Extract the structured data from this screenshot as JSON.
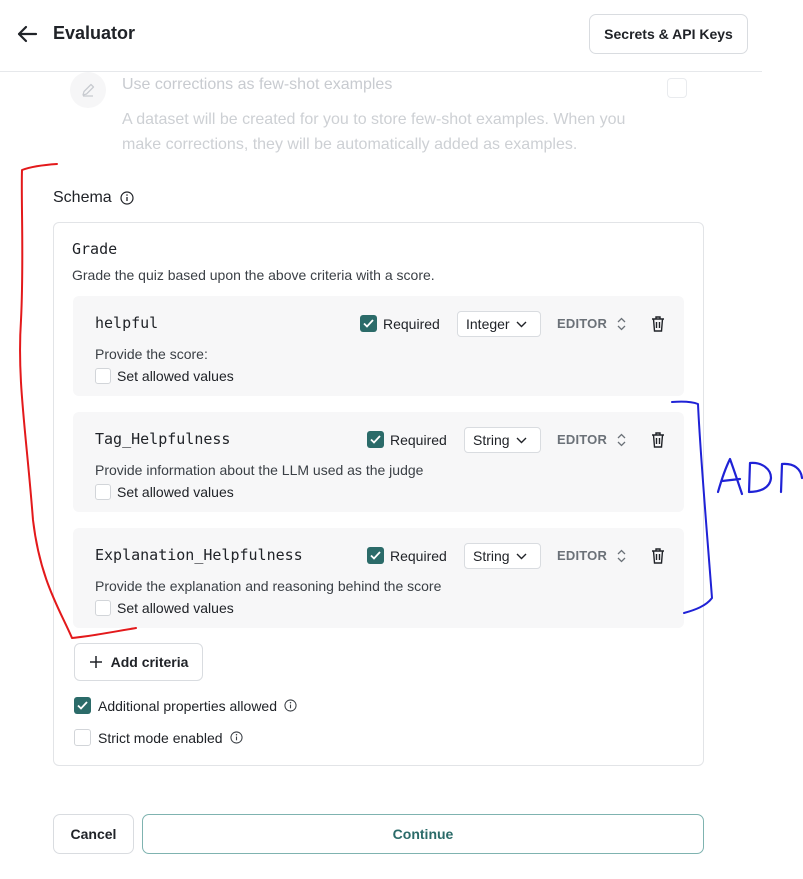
{
  "header": {
    "title": "Evaluator",
    "secrets_button": "Secrets & API Keys"
  },
  "fewshot": {
    "title": "Use corrections as few-shot examples",
    "description": "A dataset will be created for you to store few-shot examples. When you make corrections, they will be automatically added as examples."
  },
  "schema": {
    "label": "Schema",
    "name": "Grade",
    "description": "Grade the quiz based upon the above criteria with a score.",
    "criteria": [
      {
        "name": "helpful",
        "required_label": "Required",
        "type": "Integer",
        "editor_label": "EDITOR",
        "description": "Provide the score:",
        "allowed_label": "Set allowed values"
      },
      {
        "name": "Tag_Helpfulness",
        "required_label": "Required",
        "type": "String",
        "editor_label": "EDITOR",
        "description": "Provide information about the LLM used as the judge",
        "allowed_label": "Set allowed values"
      },
      {
        "name": "Explanation_Helpfulness",
        "required_label": "Required",
        "type": "String",
        "editor_label": "EDITOR",
        "description": "Provide the explanation and reasoning behind the score",
        "allowed_label": "Set allowed values"
      }
    ],
    "add_criteria": "Add criteria",
    "additional_properties": "Additional properties allowed",
    "strict_mode": "Strict mode enabled"
  },
  "footer": {
    "cancel": "Cancel",
    "continue": "Continue"
  },
  "annotations": {
    "handwritten_text": "ADD",
    "red_color": "#e3191b",
    "blue_color": "#1f22d6"
  },
  "colors": {
    "accent": "#2b6b69",
    "border": "#d9dce0"
  }
}
